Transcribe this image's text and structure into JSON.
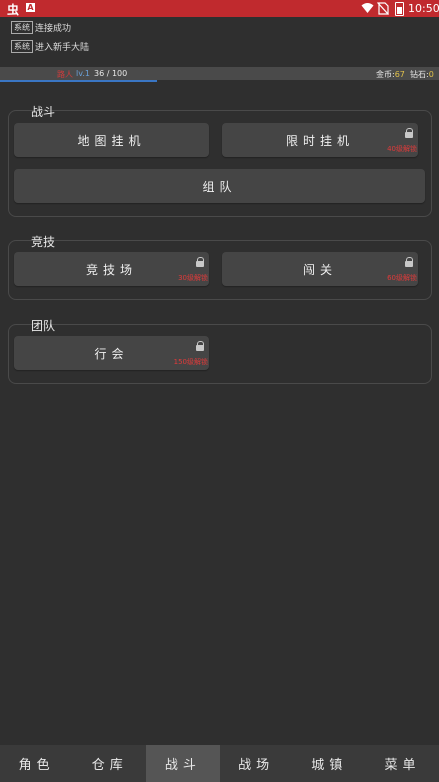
{
  "statusbar": {
    "app_glyph": "虫",
    "a_glyph": "A",
    "time": "10:50",
    "icons": [
      "wifi-icon",
      "no-sim-icon",
      "battery-icon"
    ]
  },
  "log": [
    {
      "tag": "系统",
      "text": "连接成功"
    },
    {
      "tag": "系统",
      "text": "进入新手大陆"
    }
  ],
  "player": {
    "name": "路人",
    "level": "lv.1",
    "exp": "36 / 100",
    "coins_label": "金币:",
    "coins": "67",
    "diamonds_label": "钻石:",
    "diamonds": "0"
  },
  "sections": {
    "battle": {
      "title": "战斗",
      "map_idle": "地图挂机",
      "timed_idle": "限时挂机",
      "timed_idle_lock": "40级解锁",
      "team": "组队"
    },
    "arena": {
      "title": "竞技",
      "arena": "竞技场",
      "arena_lock": "30级解锁",
      "challenge": "闯关",
      "challenge_lock": "60级解锁"
    },
    "group": {
      "title": "团队",
      "guild": "行会",
      "guild_lock": "150级解锁"
    }
  },
  "nav": [
    "角色",
    "仓库",
    "战斗",
    "战场",
    "城镇",
    "菜单"
  ],
  "nav_active": "战斗",
  "colors": {
    "statusbar": "#c02a2e",
    "background": "#2f2f2f",
    "button": "#454545",
    "lock_text": "#e03a3a",
    "currency": "#e1c14a"
  }
}
